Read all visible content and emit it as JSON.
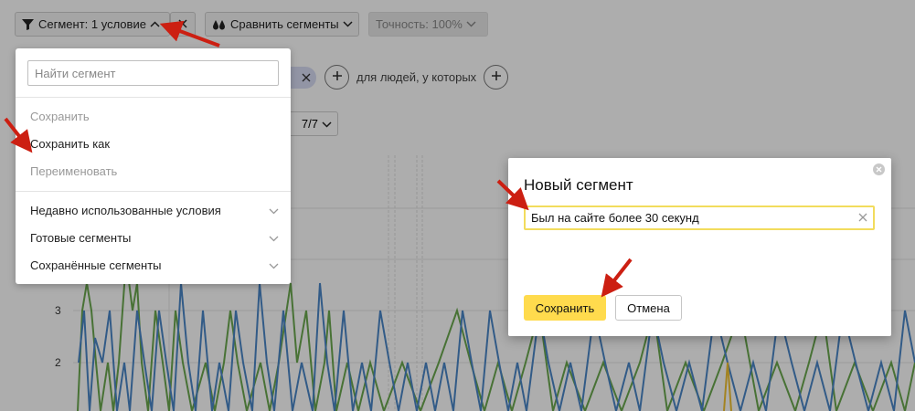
{
  "toolbar": {
    "segment_label": "Сегмент: 1 условие",
    "compare_label": "Сравнить сегменты",
    "accuracy_label": "Точность: 100%"
  },
  "conditions": {
    "text": "для людей, у которых"
  },
  "period": {
    "value": "7/7"
  },
  "chart": {
    "y_ticks": [
      "3",
      "2"
    ],
    "colors": {
      "blue": "#4a86c8",
      "green": "#6aa84f",
      "yellow": "#f1c232"
    }
  },
  "dropdown": {
    "search_placeholder": "Найти сегмент",
    "actions": [
      {
        "label": "Сохранить",
        "enabled": false
      },
      {
        "label": "Сохранить как",
        "enabled": true
      },
      {
        "label": "Переименовать",
        "enabled": false
      }
    ],
    "groups": [
      {
        "label": "Недавно использованные условия"
      },
      {
        "label": "Готовые сегменты"
      },
      {
        "label": "Сохранённые сегменты"
      }
    ]
  },
  "dialog": {
    "title": "Новый сегмент",
    "name_value": "Был на сайте более 30 секунд",
    "save_label": "Сохранить",
    "cancel_label": "Отмена"
  },
  "colors": {
    "accent_yellow": "#ffdb4d",
    "annotation_red": "#cc1f12"
  }
}
